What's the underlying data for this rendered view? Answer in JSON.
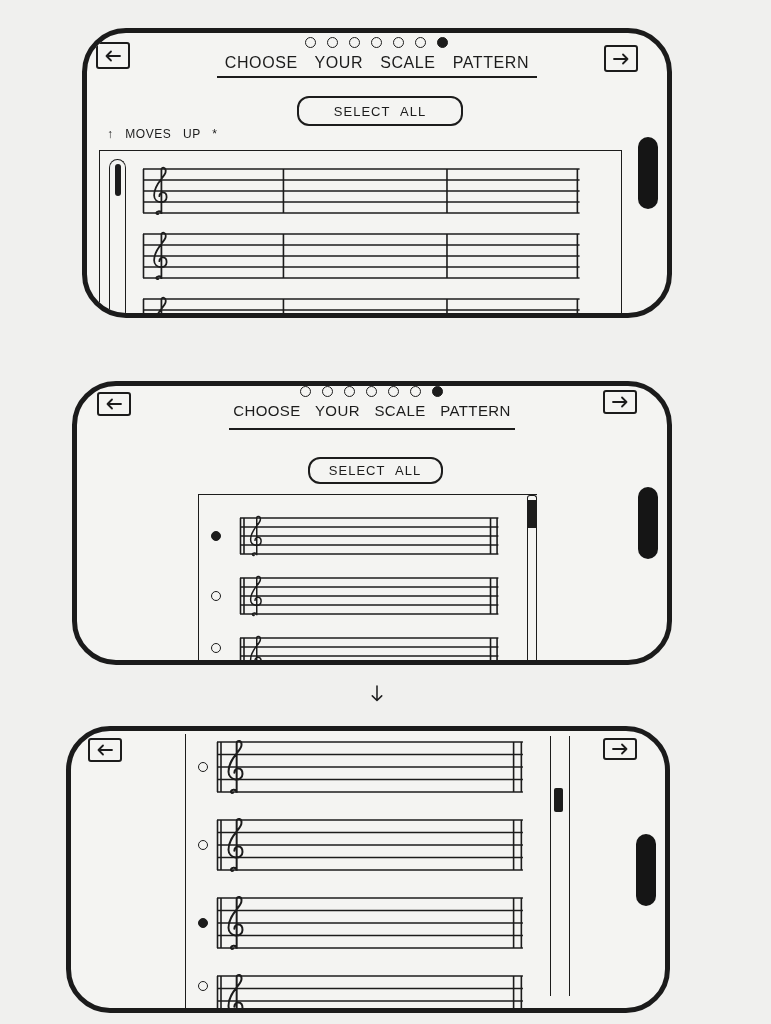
{
  "screens": [
    {
      "kind": "wide",
      "page_dots": [
        {
          "selected": false
        },
        {
          "selected": false
        },
        {
          "selected": false
        },
        {
          "selected": false
        },
        {
          "selected": false
        },
        {
          "selected": false
        },
        {
          "selected": true
        }
      ],
      "title": "CHOOSE YOUR SCALE PATTERN",
      "select_all": "SELECT ALL",
      "note": "↑ MOVES UP *",
      "staves": [
        {
          "kind": "measured"
        },
        {
          "kind": "measured"
        },
        {
          "kind": "measured"
        }
      ]
    },
    {
      "kind": "panel",
      "page_dots": [
        {
          "selected": false
        },
        {
          "selected": false
        },
        {
          "selected": false
        },
        {
          "selected": false
        },
        {
          "selected": false
        },
        {
          "selected": false
        },
        {
          "selected": true
        }
      ],
      "title": "CHOOSE YOUR SCALE PATTERN",
      "select_all": "SELECT ALL",
      "staves": [
        {
          "kind": "choice",
          "selected": true
        },
        {
          "kind": "choice",
          "selected": false
        },
        {
          "kind": "choice",
          "selected": false
        }
      ]
    },
    {
      "kind": "scrolled",
      "staves": [
        {
          "kind": "choice",
          "selected": false
        },
        {
          "kind": "choice",
          "selected": false
        },
        {
          "kind": "choice",
          "selected": true
        },
        {
          "kind": "choice",
          "selected": false
        }
      ]
    }
  ]
}
